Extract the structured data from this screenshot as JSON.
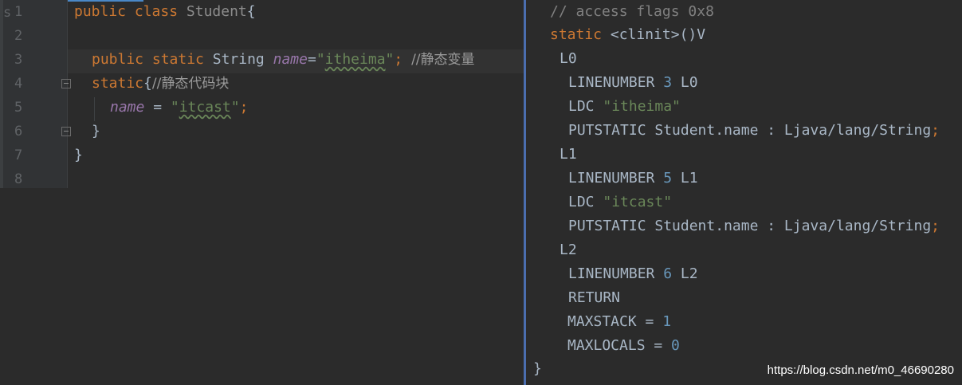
{
  "editor": {
    "gutter_fragment": "s",
    "line_numbers": [
      "1",
      "2",
      "3",
      "4",
      "5",
      "6",
      "7",
      "8"
    ],
    "line1": {
      "kw1": "public",
      "kw2": "class",
      "name": "Student",
      "brace": "{"
    },
    "line3": {
      "kw1": "public",
      "kw2": "static",
      "type": "String",
      "field": "name",
      "eq": "=",
      "q1": "\"",
      "value": "itheima",
      "q2": "\"",
      "semi": ";",
      "comment": "//静态变量"
    },
    "line4": {
      "kw": "static",
      "brace": "{",
      "comment": "//静态代码块"
    },
    "line5": {
      "field": "name",
      "eq": " = ",
      "q1": "\"",
      "value": "itcast",
      "q2": "\"",
      "semi": ";"
    },
    "line6": {
      "brace": "}"
    },
    "line7": {
      "brace": "}"
    }
  },
  "bytecode": {
    "comment": "// access flags 0x8",
    "signature_kw": "static",
    "signature_rest": " <clinit>()V",
    "l0": "L0",
    "linenumber_1": {
      "op": "LINENUMBER",
      "num": "3",
      "label": "L0"
    },
    "ldc_1": {
      "op": "LDC",
      "value": "\"itheima\""
    },
    "putstatic_1": {
      "text": "PUTSTATIC Student.name : Ljava/lang/String",
      "semi": ";"
    },
    "l1": "L1",
    "linenumber_2": {
      "op": "LINENUMBER",
      "num": "5",
      "label": "L1"
    },
    "ldc_2": {
      "op": "LDC",
      "value": "\"itcast\""
    },
    "putstatic_2": {
      "text": "PUTSTATIC Student.name : Ljava/lang/String",
      "semi": ";"
    },
    "l2": "L2",
    "linenumber_3": {
      "op": "LINENUMBER",
      "num": "6",
      "label": "L2"
    },
    "return": "RETURN",
    "maxstack": {
      "label": "MAXSTACK = ",
      "num": "1"
    },
    "maxlocals": {
      "label": "MAXLOCALS = ",
      "num": "0"
    },
    "closing": "}"
  },
  "watermark": "https://blog.csdn.net/m0_46690280"
}
